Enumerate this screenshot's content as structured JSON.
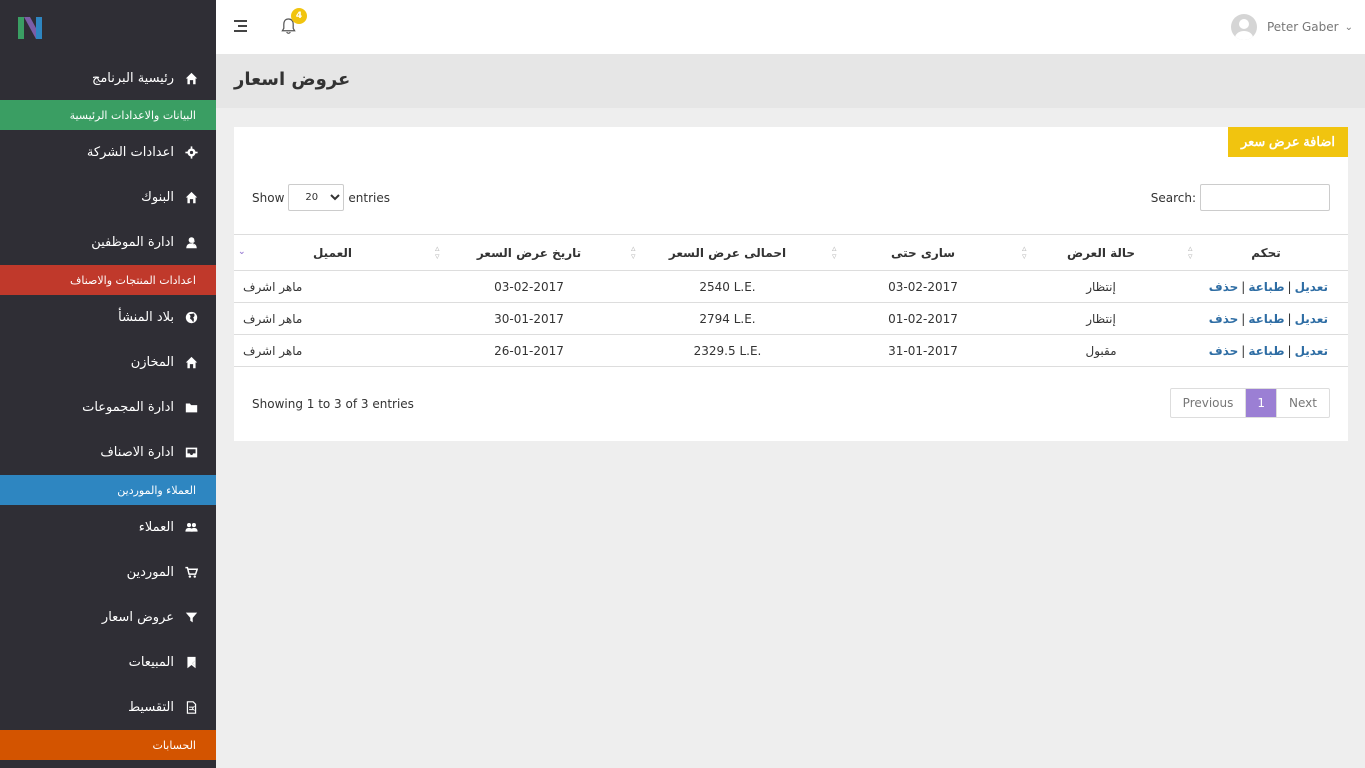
{
  "sidebar": {
    "items": [
      {
        "label": "رئيسية البرنامج",
        "icon": "home-icon"
      },
      {
        "section": "البيانات والاعدادات الرئيسية",
        "color": "#3a9e63"
      },
      {
        "label": "اعدادات الشركة",
        "icon": "gear-icon"
      },
      {
        "label": "البنوك",
        "icon": "home-icon"
      },
      {
        "label": "ادارة الموظفين",
        "icon": "user-icon",
        "chevron": "‹"
      },
      {
        "section": "اعدادات المنتجات والاصناف",
        "color": "#c0392b"
      },
      {
        "label": "بلاد المنشأ",
        "icon": "globe-icon"
      },
      {
        "label": "المخازن",
        "icon": "home-icon"
      },
      {
        "label": "ادارة المجموعات",
        "icon": "folder-icon"
      },
      {
        "label": "ادارة الاصناف",
        "icon": "inbox-icon"
      },
      {
        "section": "العملاء والموردين",
        "color": "#2e86c1"
      },
      {
        "label": "العملاء",
        "icon": "users-icon"
      },
      {
        "label": "الموردين",
        "icon": "cart-icon"
      },
      {
        "label": "عروض اسعار",
        "icon": "filter-icon"
      },
      {
        "label": "المبيعات",
        "icon": "bookmark-icon",
        "chevron": "‹"
      },
      {
        "label": "التقسيط",
        "icon": "document-icon",
        "chevron": "‹"
      },
      {
        "section": "الحسابات",
        "color": "#d35400"
      }
    ]
  },
  "topbar": {
    "notifications_count": "4",
    "user_name": "Peter Gaber",
    "caret": "⌄"
  },
  "page": {
    "title": "عروض اسعار",
    "add_button": "اضافة عرض سعر"
  },
  "table_controls": {
    "show_label": "Show",
    "entries_label": "entries",
    "page_length": "20",
    "search_label": "Search:"
  },
  "table": {
    "headers": [
      "العميل",
      "تاريخ عرض السعر",
      "احمالى عرض السعر",
      "سارى حتى",
      "حالة العرض",
      "تحكم"
    ],
    "rows": [
      {
        "client": "ماهر اشرف",
        "date": "03-02-2017",
        "total": "2540 L.E.",
        "valid_until": "03-02-2017",
        "status": "إنتظار"
      },
      {
        "client": "ماهر اشرف",
        "date": "30-01-2017",
        "total": "2794 L.E.",
        "valid_until": "01-02-2017",
        "status": "إنتظار"
      },
      {
        "client": "ماهر اشرف",
        "date": "26-01-2017",
        "total": "2329.5 L.E.",
        "valid_until": "31-01-2017",
        "status": "مقبول"
      }
    ],
    "actions": {
      "edit": "تعديل",
      "print": "طباعة",
      "delete": "حذف",
      "separator": "|"
    }
  },
  "footer": {
    "info": "Showing 1 to 3 of 3 entries",
    "previous": "Previous",
    "current_page": "1",
    "next": "Next"
  },
  "colors": {
    "sidebar_bg": "#2f2e35",
    "accent_yellow": "#f1c40f",
    "pagination_active": "#9b7fd4",
    "action_link": "#2e6da4"
  }
}
